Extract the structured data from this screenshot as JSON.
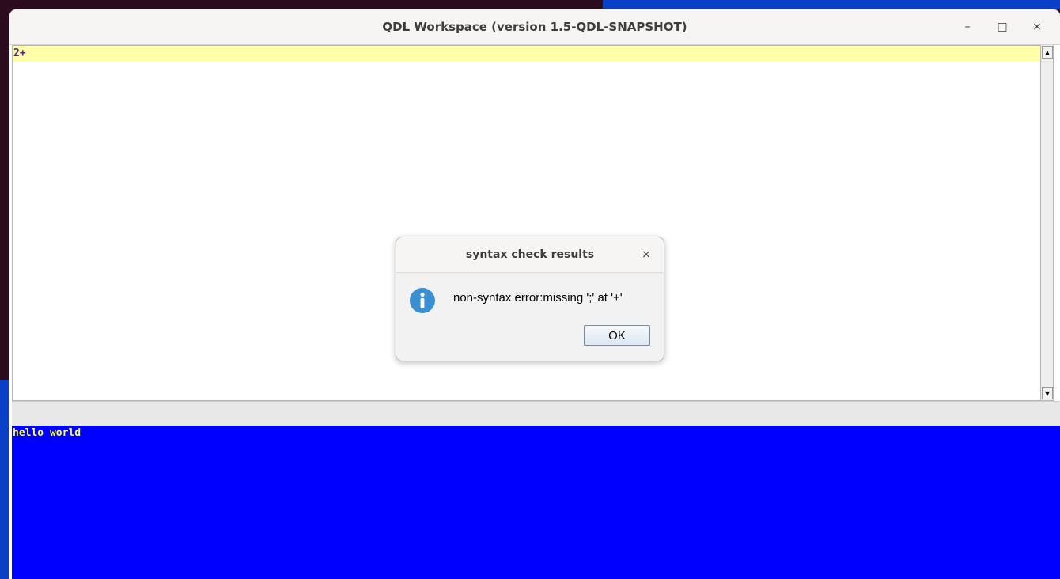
{
  "window": {
    "title": "QDL Workspace (version 1.5-QDL-SNAPSHOT)",
    "controls": {
      "minimize": "–",
      "maximize": "□",
      "close": "×"
    }
  },
  "editor": {
    "current_line": "2+",
    "scroll_up_glyph": "▲",
    "scroll_down_glyph": "▼"
  },
  "console": {
    "output": "hello world"
  },
  "dialog": {
    "title": "syntax check results",
    "close_glyph": "×",
    "icon": "info-icon",
    "message": "non-syntax error:missing ';' at '+'",
    "ok_label": "OK"
  },
  "colors": {
    "editor_highlight": "#ffffa8",
    "console_background": "#0000ff",
    "console_text": "#ffff33",
    "info_icon": "#3a8fd0"
  }
}
